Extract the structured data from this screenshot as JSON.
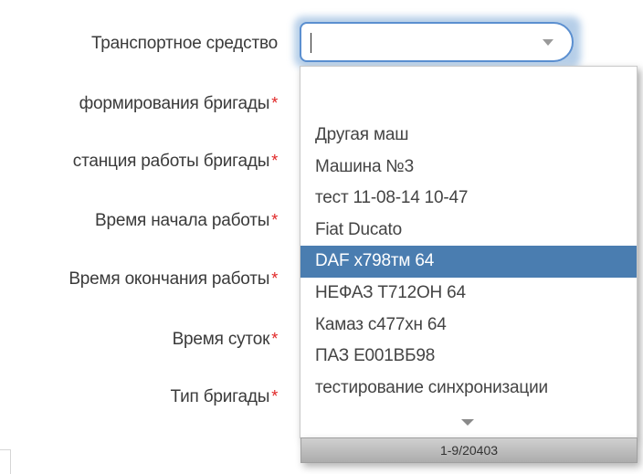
{
  "form": {
    "fields": [
      {
        "label": "Транспортное средство",
        "required": false
      },
      {
        "label": "формирования бригады",
        "required": true
      },
      {
        "label": "станция работы бригады",
        "required": true
      },
      {
        "label": "Время начала работы",
        "required": true
      },
      {
        "label": "Время окончания работы",
        "required": true
      },
      {
        "label": "Время суток",
        "required": true
      },
      {
        "label": "Тип бригады",
        "required": true
      }
    ],
    "required_mark": "*"
  },
  "vehicle_select": {
    "value": "",
    "options": [
      "Другая маш",
      "Машина №3",
      "тест 11-08-14 10-47",
      "Fiat Ducato",
      "DAF х798тм 64",
      "НЕФАЗ Т712ОН 64",
      "Камаз с477хн 64",
      "ПАЗ Е001ВБ98",
      "тестирование синхронизации"
    ],
    "highlighted_option": "DAF х798тм 64",
    "pager_text": "1-9/20403"
  },
  "colors": {
    "highlight": "#4a7db0",
    "focus_border": "#5b8fd0",
    "required": "#e02525"
  },
  "icons": {
    "select_arrow": "chevron-down-icon",
    "scroll_down": "chevron-down-icon"
  }
}
